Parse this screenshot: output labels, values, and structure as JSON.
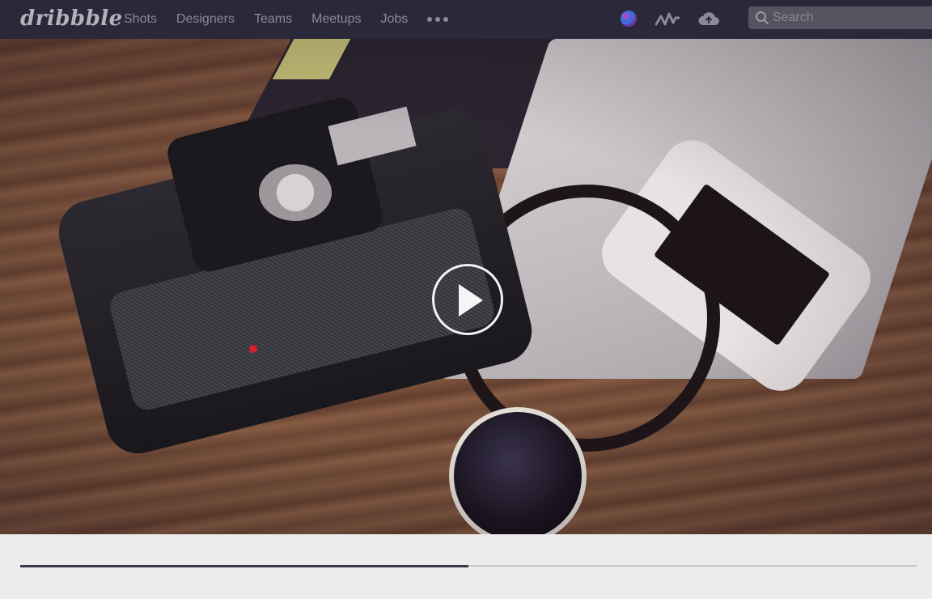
{
  "header": {
    "logo": "dribbble",
    "nav": [
      "Shots",
      "Designers",
      "Teams",
      "Meetups",
      "Jobs"
    ],
    "more_icon": "more-dots-icon",
    "icons": [
      "globe-icon",
      "activity-icon",
      "upload-cloud-icon"
    ],
    "search": {
      "placeholder": "Search",
      "value": ""
    }
  },
  "hero": {
    "media": "camera-photo",
    "play_icon": "play-icon"
  },
  "player": {
    "progress": 0.5
  },
  "colors": {
    "topbar": "#2b2839",
    "nav_text": "#8c8a98",
    "page_bg": "#ececec",
    "progress_fill": "#3a3845",
    "progress_track": "#c7c6cb"
  }
}
